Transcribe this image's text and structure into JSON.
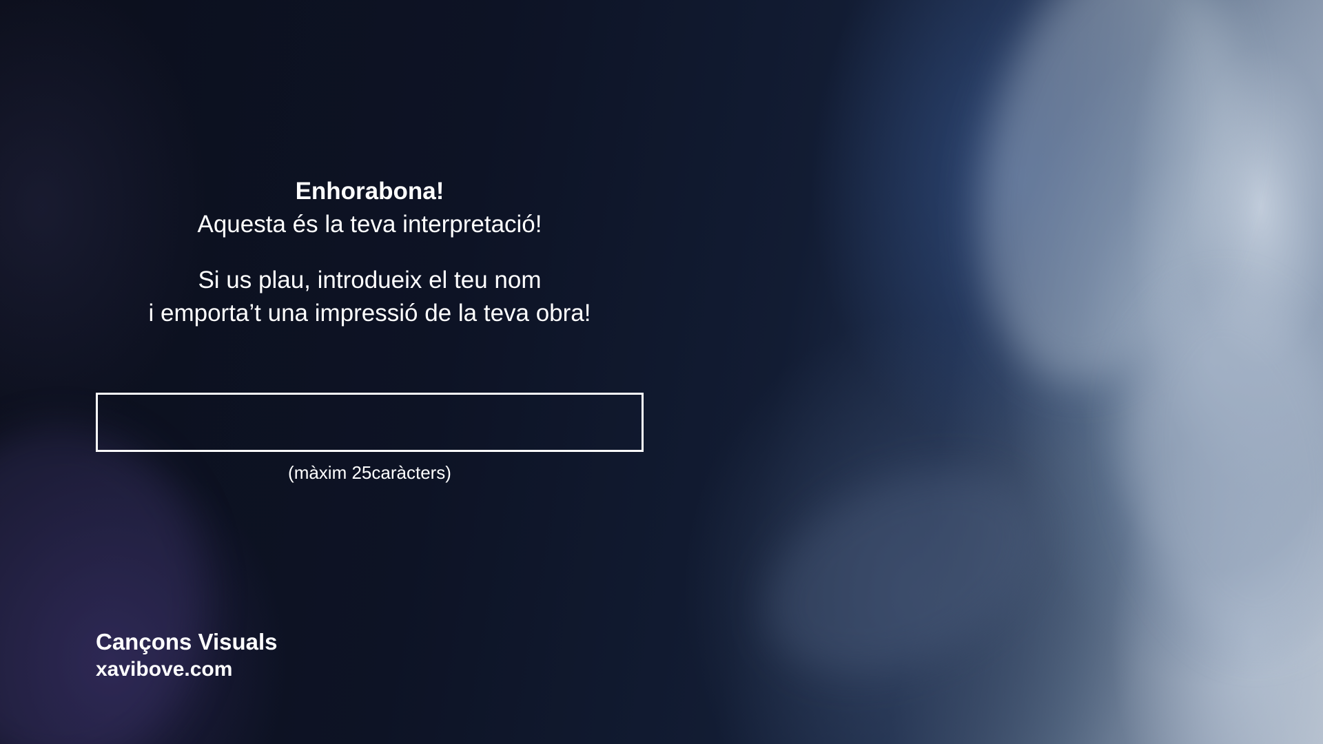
{
  "message": {
    "headline": "Enhorabona!",
    "subline": "Aquesta és la teva interpretació!",
    "instruction_line1": "Si us plau, introdueix el teu nom",
    "instruction_line2": "i emporta’t una impressió de la teva obra!"
  },
  "name_field": {
    "value": "",
    "placeholder": "",
    "hint": "(màxim 25caràcters)"
  },
  "brand": {
    "name": "Cançons Visuals",
    "url": "xavibove.com"
  }
}
